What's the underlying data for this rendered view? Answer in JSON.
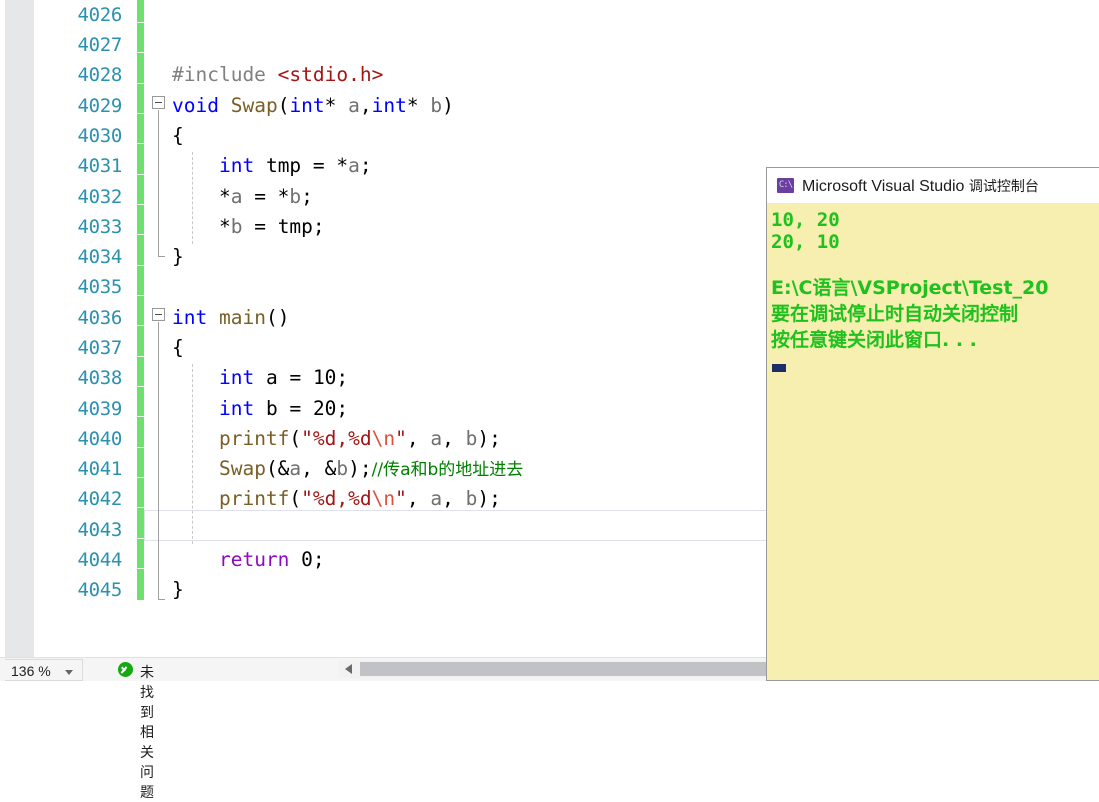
{
  "editor": {
    "line_numbers": [
      "4026",
      "4027",
      "4028",
      "4029",
      "4030",
      "4031",
      "4032",
      "4033",
      "4034",
      "4035",
      "4036",
      "4037",
      "4038",
      "4039",
      "4040",
      "4041",
      "4042",
      "4043",
      "4044",
      "4045"
    ],
    "code_lines": [
      {
        "n": "4026",
        "text": ""
      },
      {
        "n": "4027",
        "text": ""
      },
      {
        "n": "4028",
        "text": "#include <stdio.h>"
      },
      {
        "n": "4029",
        "text": "void Swap(int* a,int* b)"
      },
      {
        "n": "4030",
        "text": "{"
      },
      {
        "n": "4031",
        "text": "    int tmp = *a;"
      },
      {
        "n": "4032",
        "text": "    *a = *b;"
      },
      {
        "n": "4033",
        "text": "    *b = tmp;"
      },
      {
        "n": "4034",
        "text": "}"
      },
      {
        "n": "4035",
        "text": ""
      },
      {
        "n": "4036",
        "text": "int main()"
      },
      {
        "n": "4037",
        "text": "{"
      },
      {
        "n": "4038",
        "text": "    int a = 10;"
      },
      {
        "n": "4039",
        "text": "    int b = 20;"
      },
      {
        "n": "4040",
        "text": "    printf(\"%d,%d\\n\", a, b);"
      },
      {
        "n": "4041",
        "text": "    Swap(&a, &b);//传a和b的地址进去"
      },
      {
        "n": "4042",
        "text": "    printf(\"%d,%d\\n\", a, b);"
      },
      {
        "n": "4043",
        "text": ""
      },
      {
        "n": "4044",
        "text": "    return 0;"
      },
      {
        "n": "4045",
        "text": "}"
      }
    ],
    "tokens": {
      "include_directive": "#include",
      "include_header": "<stdio.h>",
      "kw_void": "void",
      "fn_swap": "Swap",
      "kw_int": "int",
      "kw_return": "return",
      "fn_printf": "printf",
      "fn_main": "main",
      "ident_a": "a",
      "ident_b": "b",
      "ident_tmp": "tmp",
      "lit_10": "10",
      "lit_20": "20",
      "lit_0": "0",
      "fmt_string": "\"%d,%d",
      "fmt_escape": "\\n",
      "fmt_string_close": "\"",
      "comment": "//传a和b的地址进去"
    },
    "colors": {
      "keyword": "#0000ff",
      "control": "#8f08c4",
      "function": "#795e26",
      "string": "#a31515",
      "escape": "#e1503c",
      "preprocessor": "#808080",
      "comment": "#008000",
      "line_number": "#2b91af",
      "change_bar": "#6ee06e",
      "gutter_bg": "#e6e7e8"
    }
  },
  "status_bar": {
    "zoom_level": "136 %",
    "issue_text": "未找到相关问题",
    "issue_icon": "check-circle-icon",
    "scroll_left_arrow": "caret-left-icon"
  },
  "console": {
    "icon": "console-app-icon",
    "icon_glyph": "C:\\",
    "title_app": "Microsoft Visual Studio ",
    "title_cjk": "调试控制台",
    "lines": [
      "10, 20",
      "20, 10",
      "",
      "E:\\C语言\\VSProject\\Test_20",
      "要在调试停止时自动关闭控制",
      "按任意键关闭此窗口. . ."
    ],
    "background": "#f6efaf",
    "text_color": "#1ec11e"
  }
}
